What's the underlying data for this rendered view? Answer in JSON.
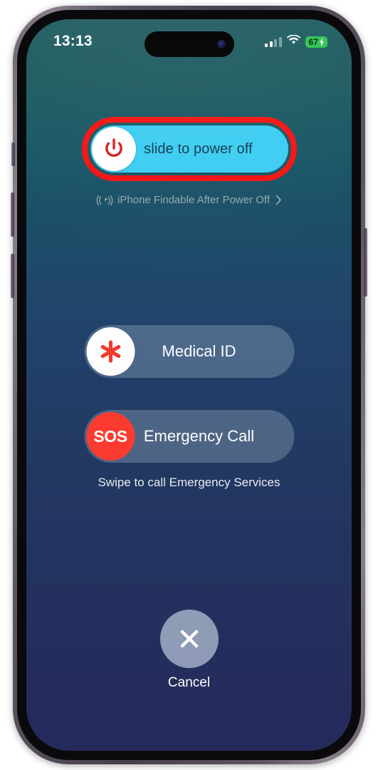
{
  "status_bar": {
    "time": "13:13",
    "signal_icon": "cellular-signal-icon",
    "signal_bars_filled": 2,
    "signal_bars_total": 4,
    "wifi_icon": "wifi-icon",
    "battery_percent": "67",
    "battery_charging": true,
    "battery_color": "#34c759"
  },
  "power_off": {
    "label": "slide to power off",
    "icon": "power-icon",
    "track_color": "#3dcdf2",
    "knob_color": "#fdfdfd",
    "icon_color": "#d32020",
    "annotation_color": "#f61414",
    "annotated": true
  },
  "findable": {
    "icon": "findable-broadcast-icon",
    "label": "iPhone Findable After Power Off",
    "chevron": "chevron-right-icon"
  },
  "medical_id": {
    "label": "Medical ID",
    "icon": "medical-asterisk-icon",
    "icon_color": "#f03a2e",
    "knob_color": "#fdfdfd"
  },
  "emergency_call": {
    "label": "Emergency Call",
    "icon": "sos-icon",
    "icon_text": "SOS",
    "knob_color": "#fb3b30",
    "caption": "Swipe to call Emergency Services"
  },
  "cancel": {
    "label": "Cancel",
    "icon": "close-icon",
    "button_color": "#becbdd"
  },
  "device": {
    "frame_color": "#5b5260",
    "screen_gradient_top": "#1d5b5f",
    "screen_gradient_bottom": "#252a5c",
    "buttons": [
      "mute-switch",
      "volume-up",
      "volume-down",
      "power-button"
    ]
  }
}
